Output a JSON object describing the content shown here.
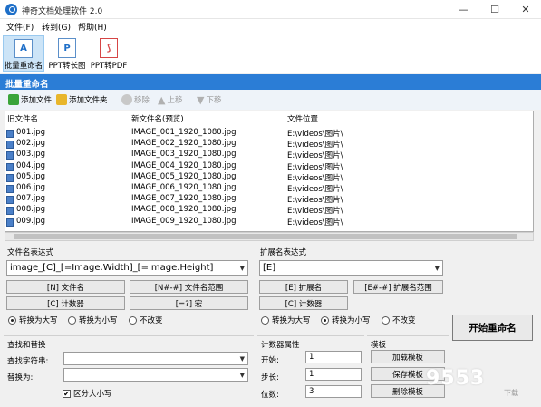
{
  "window": {
    "title": "神奇文档处理软件 2.0",
    "minimize": "—",
    "maximize": "☐",
    "close": "✕"
  },
  "menu": [
    "文件(F)",
    "转到(G)",
    "帮助(H)"
  ],
  "toolbar": [
    {
      "label": "批量重命名",
      "icon": "rename-doc-icon"
    },
    {
      "label": "PPT转长图",
      "icon": "ppt-icon"
    },
    {
      "label": "PPT转PDF",
      "icon": "pdf-icon"
    }
  ],
  "section_title": "批量重命名",
  "subtoolbar": {
    "add_file": "添加文件",
    "add_folder": "添加文件夹",
    "remove": "移除",
    "move_up": "上移",
    "move_down": "下移"
  },
  "file_list": {
    "columns": [
      "旧文件名",
      "新文件名(预览)",
      "文件位置"
    ],
    "rows": [
      [
        "001.jpg",
        "IMAGE_001_1920_1080.jpg",
        "E:\\videos\\图片\\"
      ],
      [
        "002.jpg",
        "IMAGE_002_1920_1080.jpg",
        "E:\\videos\\图片\\"
      ],
      [
        "003.jpg",
        "IMAGE_003_1920_1080.jpg",
        "E:\\videos\\图片\\"
      ],
      [
        "004.jpg",
        "IMAGE_004_1920_1080.jpg",
        "E:\\videos\\图片\\"
      ],
      [
        "005.jpg",
        "IMAGE_005_1920_1080.jpg",
        "E:\\videos\\图片\\"
      ],
      [
        "006.jpg",
        "IMAGE_006_1920_1080.jpg",
        "E:\\videos\\图片\\"
      ],
      [
        "007.jpg",
        "IMAGE_007_1920_1080.jpg",
        "E:\\videos\\图片\\"
      ],
      [
        "008.jpg",
        "IMAGE_008_1920_1080.jpg",
        "E:\\videos\\图片\\"
      ],
      [
        "009.jpg",
        "IMAGE_009_1920_1080.jpg",
        "E:\\videos\\图片\\"
      ]
    ]
  },
  "filename_expr": {
    "label": "文件名表达式",
    "value": "image_[C]_[=Image.Width]_[=Image.Height]",
    "buttons": [
      "[N] 文件名",
      "[N#-#] 文件名范围",
      "[C] 计数器",
      "[=?] 宏"
    ],
    "radios": [
      "转换为大写",
      "转换为小写",
      "不改变"
    ],
    "selected_radio": 0
  },
  "ext_expr": {
    "label": "扩展名表达式",
    "value": "[E]",
    "buttons": [
      "[E] 扩展名",
      "[E#-#] 扩展名范围",
      "[C] 计数器"
    ],
    "radios": [
      "转换为大写",
      "转换为小写",
      "不改变"
    ],
    "selected_radio": 1
  },
  "find_replace": {
    "title": "查找和替换",
    "find_label": "查找字符串:",
    "replace_label": "替换为:",
    "case_label": "区分大小写",
    "case_checked": true
  },
  "counter": {
    "title": "计数器属性",
    "start_label": "开始:",
    "start": "1",
    "step_label": "步长:",
    "step": "1",
    "digits_label": "位数:",
    "digits": "3"
  },
  "template": {
    "title": "模板",
    "load": "加载模板",
    "save": "保存模板",
    "delete": "删除模板"
  },
  "start_button": "开始重命名",
  "watermark": {
    "main": "9553",
    "sub": "下载"
  },
  "colors": {
    "accent": "#2b7dd6",
    "selected_tool": "#cce4f7"
  }
}
